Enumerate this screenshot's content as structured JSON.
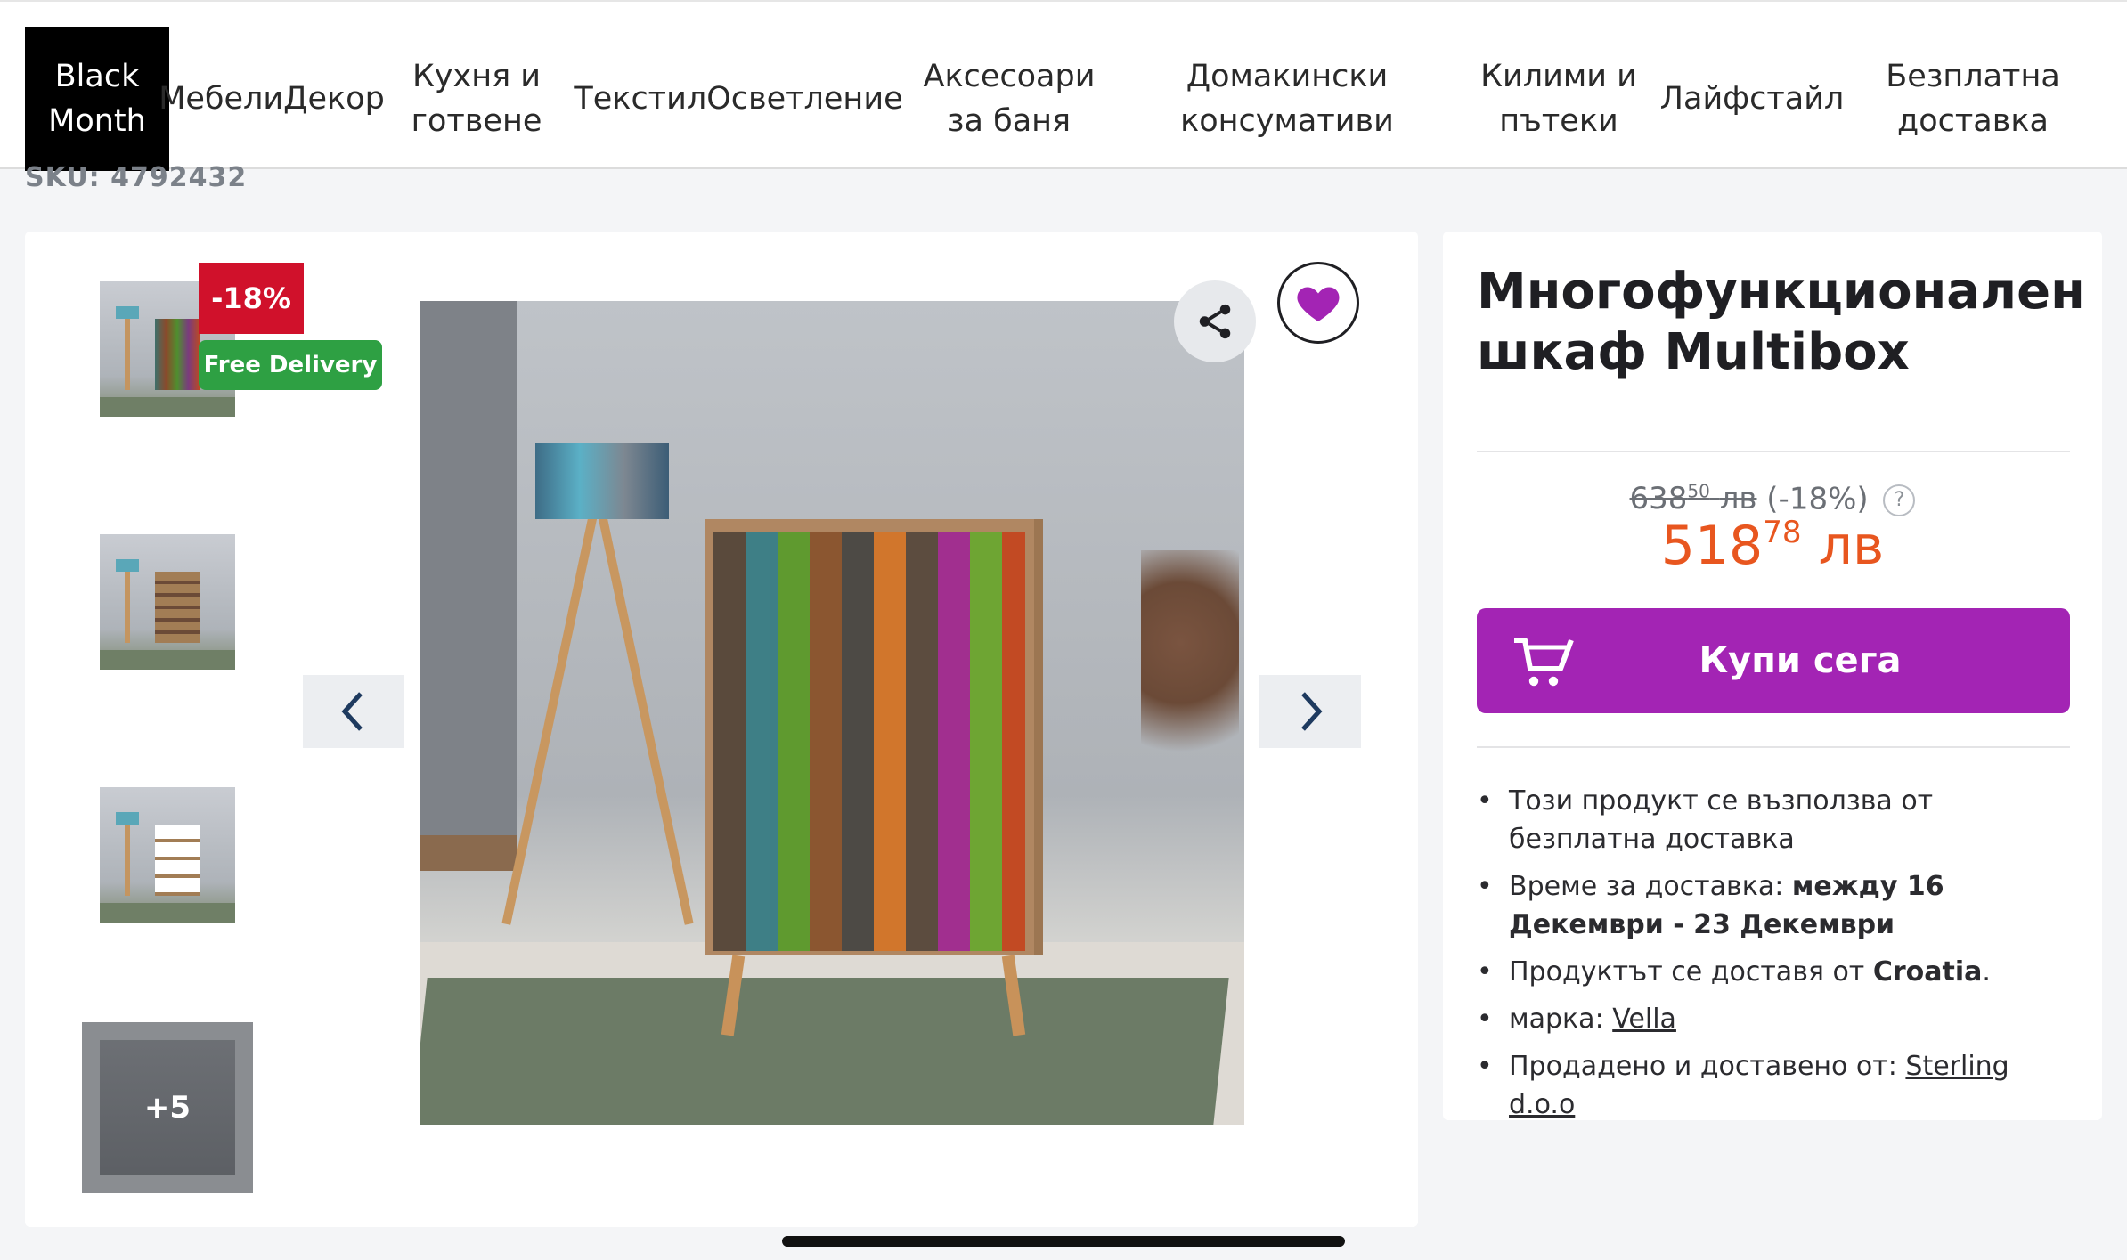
{
  "nav": {
    "items": [
      {
        "label": "Black Month",
        "active": true
      },
      {
        "label": "МебелиДекор"
      },
      {
        "label": "Кухня и готвене"
      },
      {
        "label": "ТекстилОсветление"
      },
      {
        "label": "Аксесоари за баня"
      },
      {
        "label": "Домакински консумативи"
      },
      {
        "label": "Килими и пътеки"
      },
      {
        "label": "Лайфстайл"
      },
      {
        "label": "Безплатна доставка"
      }
    ]
  },
  "product": {
    "sku": "SKU: 4792432",
    "title": "Многофункционален шкаф Multibox",
    "discount_badge": "-18%",
    "free_delivery_badge": "Free Delivery",
    "more_images_label": "+5",
    "old_price_main": "638",
    "old_price_cents": "50",
    "old_price_currency": "лв",
    "old_price_discount": "(-18%)",
    "help_icon_glyph": "?",
    "new_price_main": "518",
    "new_price_cents": "78",
    "new_price_currency": "лв",
    "buy_button_label": "Купи сега"
  },
  "details": {
    "free_delivery_text": "Този продукт се възползва от безплатна доставка",
    "delivery_time_prefix": "Време за доставка:",
    "delivery_time_value": "между 16 Декември - 23 Декември",
    "ships_from_prefix": "Продуктът се доставя от",
    "ships_from_value": "Croatia",
    "ships_from_suffix": ".",
    "brand_prefix": "марка:",
    "brand_value": "Vella",
    "seller_prefix": "Продадено и доставено от:",
    "seller_value": "Sterling d.o.o"
  },
  "icons": {
    "share": "share-icon",
    "favorite": "heart-icon",
    "prev": "chevron-left-icon",
    "next": "chevron-right-icon",
    "cart": "cart-icon"
  },
  "colors": {
    "accent": "#a324b4",
    "price": "#e8561f",
    "discount_badge": "#d0112b",
    "free_delivery_badge": "#2ea043",
    "nav_active": "#000000"
  }
}
